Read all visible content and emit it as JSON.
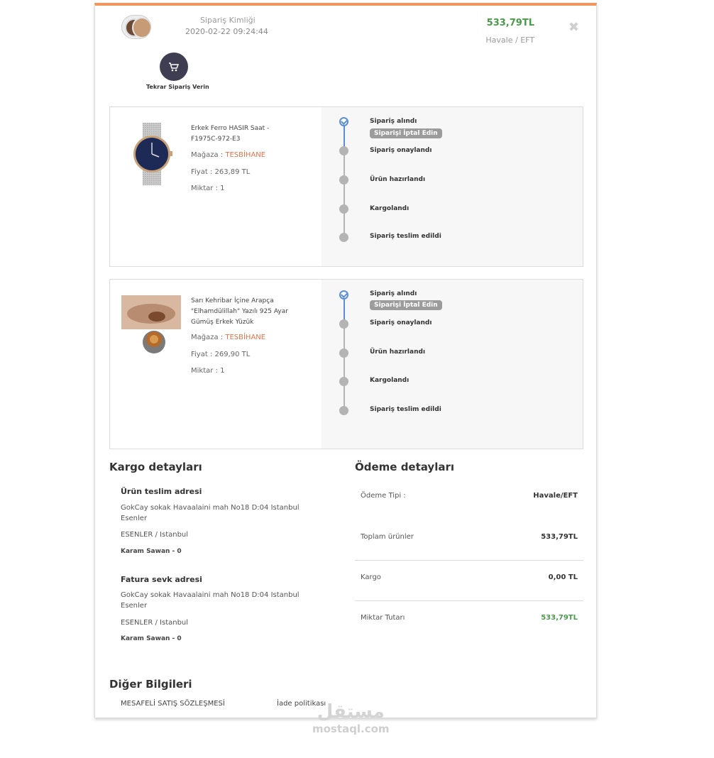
{
  "header": {
    "order_label": "Sipariş Kimliği",
    "order_date": "2020-02-22 09:24:44",
    "total": "533,79TL",
    "payment_type": "Havale / EFT",
    "close_symbol": "✖",
    "reorder_label": "Tekrar Sipariş Verin"
  },
  "items": [
    {
      "name": "Erkek Ferro HASIR Saat - F1975C-972-E3",
      "shop_label": "Mağaza : ",
      "shop": "TESBİHANE",
      "price": "Fiyat : 263,89 TL",
      "qty": "Miktar : 1",
      "image": "watch-image",
      "steps": [
        "Sipariş alındı",
        "Sipariş onaylandı",
        "Ürün hazırlandı",
        "Kargolandı",
        "Sipariş teslim edildi"
      ],
      "cancel_label": "Siparişi İptal Edin"
    },
    {
      "name": "Sarı Kehribar İçine Arapça \"Elhamdülillah\" Yazılı 925 Ayar Gümüş Erkek Yüzük",
      "shop_label": "Mağaza : ",
      "shop": "TESBİHANE",
      "price": "Fiyat : 269,90 TL",
      "qty": "Miktar : 1",
      "image": "ring-image",
      "steps": [
        "Sipariş alındı",
        "Sipariş onaylandı",
        "Ürün hazırlandı",
        "Kargolandı",
        "Sipariş teslim edildi"
      ],
      "cancel_label": "Siparişi İptal Edin"
    }
  ],
  "shipping": {
    "title": "Kargo detayları",
    "delivery": {
      "title": "Ürün teslim adresi",
      "address": "GokCay sokak Havaalaini mah No18 D:04 Istanbul Esenler",
      "city": "ESENLER / Istanbul",
      "name": "Karam Sawan - 0"
    },
    "invoice": {
      "title": "Fatura sevk adresi",
      "address": "GokCay sokak Havaalaini mah No18 D:04 Istanbul Esenler",
      "city": "ESENLER / Istanbul",
      "name": "Karam Sawan - 0"
    }
  },
  "payment": {
    "title": "Ödeme detayları",
    "rows": [
      {
        "label": "Ödeme Tipi :",
        "value": "Havale/EFT"
      },
      {
        "label": "Toplam ürünler",
        "value": "533,79TL"
      },
      {
        "label": "Kargo",
        "value": "0,00 TL"
      },
      {
        "label": "Miktar Tutarı",
        "value": "533,79TL"
      }
    ]
  },
  "other": {
    "title": "Diğer Bilgileri",
    "link1": "MESAFELİ SATIŞ SÖZLEŞMESİ",
    "link2": "İade politikası"
  },
  "watermark": {
    "arabic": "مستقل",
    "latin": "mostaql.com"
  },
  "colors": {
    "accent": "#f0955c",
    "total_green": "#4a9a4a",
    "shop_orange": "#e0734a",
    "step_blue": "#5b8ed6",
    "reorder_dark": "#3f3d52"
  }
}
